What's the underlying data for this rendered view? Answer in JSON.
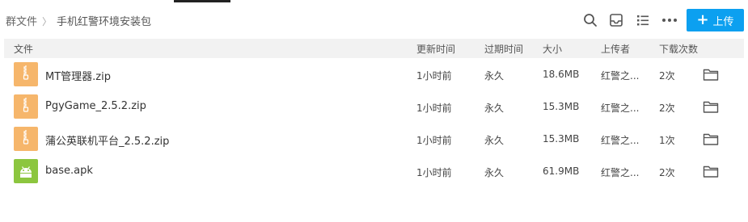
{
  "breadcrumb": {
    "root": "群文件",
    "current": "手机红警环境安装包"
  },
  "toolbar": {
    "search_icon": "search-icon",
    "inbox_icon": "inbox-icon",
    "list_view_icon": "list-view-icon",
    "more_icon": "more-icon",
    "upload_label": "上传",
    "accent_color": "#0ca0f0"
  },
  "table": {
    "columns": [
      "文件",
      "更新时间",
      "过期时间",
      "大小",
      "上传者",
      "下载次数"
    ],
    "rows": [
      {
        "name": "MT管理器.zip",
        "updated": "1小时前",
        "expires": "永久",
        "size": "18.6MB",
        "uploader": "红警之...",
        "downloads": "2次",
        "type": "zip"
      },
      {
        "name": "PgyGame_2.5.2.zip",
        "updated": "1小时前",
        "expires": "永久",
        "size": "15.3MB",
        "uploader": "红警之...",
        "downloads": "2次",
        "type": "zip"
      },
      {
        "name": "蒲公英联机平台_2.5.2.zip",
        "updated": "1小时前",
        "expires": "永久",
        "size": "15.3MB",
        "uploader": "红警之...",
        "downloads": "1次",
        "type": "zip"
      },
      {
        "name": "base.apk",
        "updated": "1小时前",
        "expires": "永久",
        "size": "61.9MB",
        "uploader": "红警之...",
        "downloads": "2次",
        "type": "apk"
      }
    ]
  },
  "colors": {
    "zip_icon": "#f6b66b",
    "apk_icon": "#8cc63f",
    "header_bg": "#f2f2f2"
  }
}
